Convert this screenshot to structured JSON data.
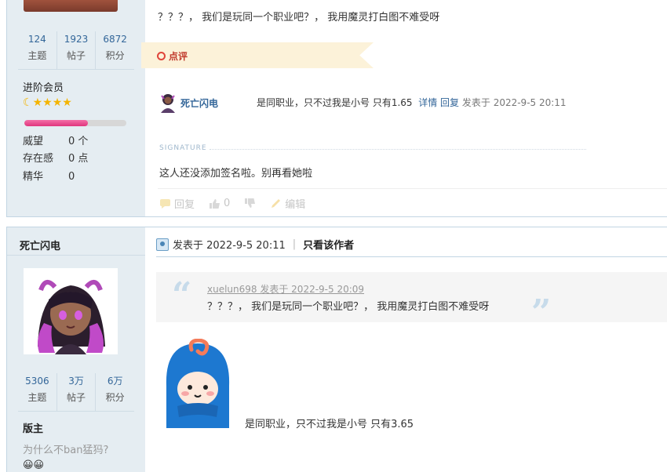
{
  "post1": {
    "stats": [
      {
        "value": "124",
        "label": "主题"
      },
      {
        "value": "1923",
        "label": "帖子"
      },
      {
        "value": "6872",
        "label": "积分"
      }
    ],
    "rank": "进阶会员",
    "level_progress": 0.62,
    "attributes": [
      {
        "key": "威望",
        "value": "0 个"
      },
      {
        "key": "存在感",
        "value": "0 点"
      },
      {
        "key": "精华",
        "value": "0"
      }
    ],
    "quote_line": "？？？， 我们是玩同一个职业吧？， 我用魔灵打白图不难受呀",
    "comment_tag": "点评",
    "comment": {
      "author": "死亡闪电",
      "text": "是同职业，只不过我是小号 只有1.65",
      "detail": "详情",
      "reply": "回复",
      "date": "发表于 2022-9-5 20:11"
    },
    "signature_label": "SIGNATURE",
    "signature": "这人还没添加签名啦。别再看她啦",
    "actions": {
      "reply": "回复",
      "likes": "0",
      "edit": "编辑"
    }
  },
  "post2": {
    "author": "死亡闪电",
    "stats": [
      {
        "value": "5306",
        "label": "主题"
      },
      {
        "value": "3万",
        "label": "帖子"
      },
      {
        "value": "6万",
        "label": "积分"
      }
    ],
    "rank": "版主",
    "motto": "为什么不ban猛犸?",
    "smileys": "😀😀",
    "posted": "发表于 2022-9-5 20:11",
    "only_author": "只看该作者",
    "quote": {
      "author": "xuelun698 发表于 2022-9-5 20:09",
      "text": "？？？， 我们是玩同一个职业吧？， 我用魔灵打白图不难受呀"
    },
    "body": "是同职业，只不过我是小号 只有3.65"
  },
  "colors": {
    "sidebar_bg": "#e5edf2",
    "border": "#c2d5e3",
    "link": "#336699",
    "comment_tag_bg": "#fcf2d9",
    "comment_tag_text": "#c0392b",
    "progress_fill": "#e0357d"
  }
}
